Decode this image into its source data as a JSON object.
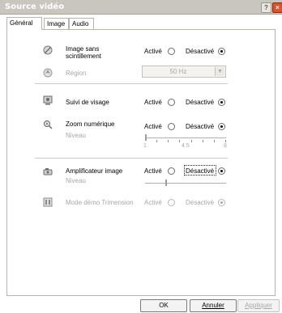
{
  "window": {
    "title": "Source vidéo",
    "help": "?",
    "close": "×"
  },
  "tabs": [
    {
      "label": "Général"
    },
    {
      "label": "Image"
    },
    {
      "label": "Audio"
    }
  ],
  "flicker": {
    "label": "Image sans scintillement",
    "on": "Activé",
    "off": "Désactivé",
    "selected": "off"
  },
  "region": {
    "label": "Région",
    "value": "50 Hz"
  },
  "face_tracking": {
    "label": "Suivi de visage",
    "on": "Activé",
    "off": "Désactivé",
    "selected": "off"
  },
  "digital_zoom": {
    "label": "Zoom numérique",
    "on": "Activé",
    "off": "Désactivé",
    "selected": "off",
    "level_label": "Niveau",
    "min_label": "1",
    "mid_label": "4.5",
    "max_label": "8"
  },
  "image_enhancer": {
    "label": "Amplificateur image",
    "on": "Activé",
    "off": "Désactivé",
    "selected": "off",
    "level_label": "Niveau"
  },
  "tridimension": {
    "label": "Mode démo Trimension",
    "on": "Activé",
    "off": "Désactivé",
    "selected": "off"
  },
  "buttons": {
    "ok": "OK",
    "cancel": "Annuler",
    "apply": "Appliquer"
  },
  "colors": {
    "disabled_text": "#a7a7a7",
    "title_text": "#ffffff",
    "close_button": "#d9542c"
  }
}
